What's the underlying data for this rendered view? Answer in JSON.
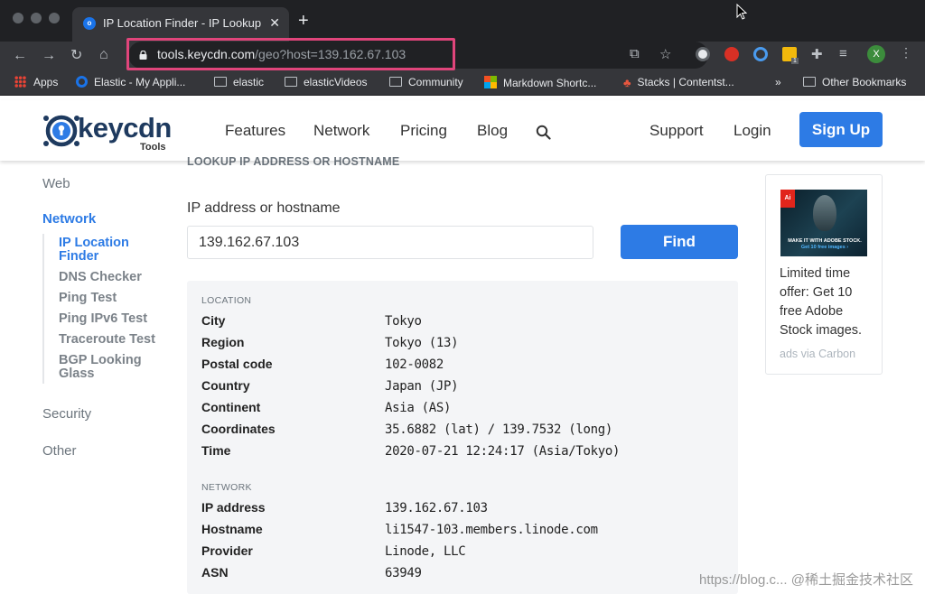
{
  "browser": {
    "tab_title": "IP Location Finder - IP Lookup",
    "url_host": "tools.keycdn.com",
    "url_path": "/geo?host=139.162.67.103",
    "profile_initial": "X",
    "extension_badge": "1"
  },
  "bookmarks": [
    {
      "label": "Apps",
      "icon": "apps-grid-icon"
    },
    {
      "label": "Elastic - My Appli...",
      "icon": "elastic-icon"
    },
    {
      "label": "elastic",
      "icon": "folder-icon"
    },
    {
      "label": "elasticVideos",
      "icon": "folder-icon"
    },
    {
      "label": "Community",
      "icon": "folder-icon"
    },
    {
      "label": "Markdown Shortc...",
      "icon": "microsoft-icon"
    },
    {
      "label": "Stacks | Contentst...",
      "icon": "stacks-icon"
    },
    {
      "label": "»",
      "icon": ""
    },
    {
      "label": "Other Bookmarks",
      "icon": "folder-icon"
    }
  ],
  "site": {
    "logo_word": "keycdn",
    "logo_sub": "Tools",
    "nav": [
      "Features",
      "Network",
      "Pricing",
      "Blog"
    ],
    "support": "Support",
    "login": "Login",
    "signup": "Sign Up"
  },
  "sidebar": {
    "web": "Web",
    "network": "Network",
    "items": [
      "IP Location Finder",
      "DNS Checker",
      "Ping Test",
      "Ping IPv6 Test",
      "Traceroute Test",
      "BGP Looking Glass"
    ],
    "security": "Security",
    "other": "Other"
  },
  "lookup": {
    "heading": "LOOKUP IP ADDRESS OR HOSTNAME",
    "label": "IP address or hostname",
    "value": "139.162.67.103",
    "button": "Find"
  },
  "location": {
    "title": "LOCATION",
    "rows": [
      {
        "key": "City",
        "value": "Tokyo"
      },
      {
        "key": "Region",
        "value": "Tokyo (13)"
      },
      {
        "key": "Postal code",
        "value": "102-0082"
      },
      {
        "key": "Country",
        "value": "Japan (JP)"
      },
      {
        "key": "Continent",
        "value": "Asia (AS)"
      },
      {
        "key": "Coordinates",
        "value": "35.6882 (lat) / 139.7532 (long)"
      },
      {
        "key": "Time",
        "value": "2020-07-21 12:24:17 (Asia/Tokyo)"
      }
    ]
  },
  "network": {
    "title": "NETWORK",
    "rows": [
      {
        "key": "IP address",
        "value": "139.162.67.103"
      },
      {
        "key": "Hostname",
        "value": "li1547-103.members.linode.com"
      },
      {
        "key": "Provider",
        "value": "Linode, LLC"
      },
      {
        "key": "ASN",
        "value": "63949"
      }
    ]
  },
  "ad": {
    "brand_mark": "Ai",
    "image_caption": "MAKE IT WITH ADOBE STOCK.",
    "image_cta": "Get 10 free images ›",
    "text": "Limited time offer: Get 10 free Adobe Stock images.",
    "via": "ads via Carbon"
  },
  "watermark": "https://blog.c... @稀土掘金技术社区",
  "colors": {
    "accent": "#2d7be5",
    "highlight_box": "#e0457b"
  }
}
